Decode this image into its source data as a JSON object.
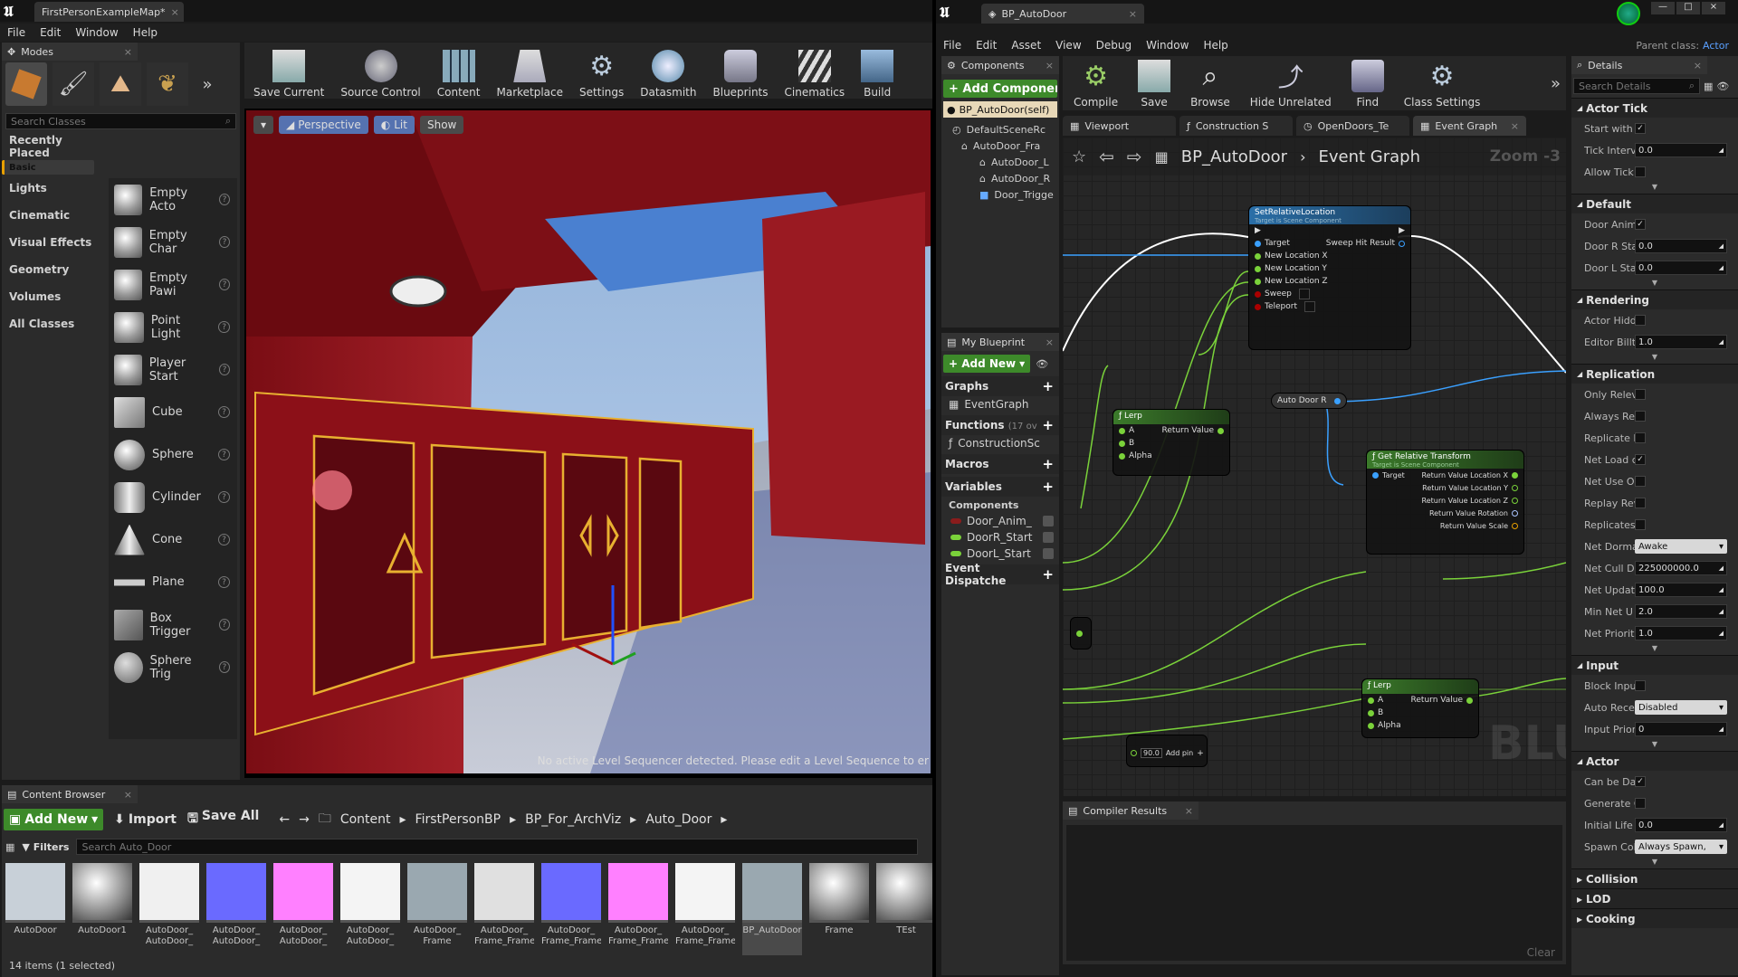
{
  "left_window": {
    "tab_title": "FirstPersonExampleMap*",
    "menu": [
      "File",
      "Edit",
      "Window",
      "Help"
    ],
    "modes": {
      "title": "Modes",
      "search_placeholder": "Search Classes",
      "categories": [
        "Recently Placed",
        "Basic",
        "Lights",
        "Cinematic",
        "Visual Effects",
        "Geometry",
        "Volumes",
        "All Classes"
      ],
      "selected_category": "Basic",
      "items": [
        "Empty Acto",
        "Empty Char",
        "Empty Pawi",
        "Point Light",
        "Player Start",
        "Cube",
        "Sphere",
        "Cylinder",
        "Cone",
        "Plane",
        "Box Trigger",
        "Sphere Trig"
      ]
    },
    "toolbar": [
      "Save Current",
      "Source Control",
      "Content",
      "Marketplace",
      "Settings",
      "Datasmith",
      "Blueprints",
      "Cinematics",
      "Build"
    ],
    "viewport": {
      "perspective": "Perspective",
      "lit": "Lit",
      "show": "Show",
      "message": "No active Level Sequencer detected. Please edit a Level Sequence to er"
    },
    "content_browser": {
      "title": "Content Browser",
      "add_new": "Add New",
      "import": "Import",
      "save_all": "Save All",
      "breadcrumbs": [
        "Content",
        "FirstPersonBP",
        "BP_For_ArchViz",
        "Auto_Door"
      ],
      "filters": "Filters",
      "search_placeholder": "Search Auto_Door",
      "assets": [
        {
          "l1": "AutoDoor",
          "l2": ""
        },
        {
          "l1": "AutoDoor1",
          "l2": ""
        },
        {
          "l1": "AutoDoor_",
          "l2": "AutoDoor_"
        },
        {
          "l1": "AutoDoor_",
          "l2": "AutoDoor_"
        },
        {
          "l1": "AutoDoor_",
          "l2": "AutoDoor_"
        },
        {
          "l1": "AutoDoor_",
          "l2": "AutoDoor_"
        },
        {
          "l1": "AutoDoor_",
          "l2": "Frame"
        },
        {
          "l1": "AutoDoor_",
          "l2": "Frame_Frame"
        },
        {
          "l1": "AutoDoor_",
          "l2": "Frame_Frame"
        },
        {
          "l1": "AutoDoor_",
          "l2": "Frame_Frame"
        },
        {
          "l1": "AutoDoor_",
          "l2": "Frame_Frame"
        },
        {
          "l1": "BP_AutoDoor",
          "l2": ""
        },
        {
          "l1": "Frame",
          "l2": ""
        },
        {
          "l1": "TEst",
          "l2": ""
        }
      ],
      "status": "14 items (1 selected)"
    }
  },
  "right_window": {
    "tab_title": "BP_AutoDoor",
    "parent_class_label": "Parent class:",
    "parent_class_value": "Actor",
    "menu": [
      "File",
      "Edit",
      "Asset",
      "View",
      "Debug",
      "Window",
      "Help"
    ],
    "components": {
      "title": "Components",
      "add_button": "+ Add Component",
      "self": "BP_AutoDoor(self)",
      "tree": [
        "DefaultSceneRc",
        "AutoDoor_Fra",
        "AutoDoor_L",
        "AutoDoor_R",
        "Door_Trigge"
      ]
    },
    "toolbar": [
      "Compile",
      "Save",
      "Browse",
      "Hide Unrelated",
      "Find",
      "Class Settings"
    ],
    "tabs": [
      "Viewport",
      "Construction S",
      "OpenDoors_Te",
      "Event Graph"
    ],
    "graph_breadcrumb": [
      "BP_AutoDoor",
      "Event Graph"
    ],
    "zoom": "Zoom -3",
    "watermark": "BLUEPRINT",
    "my_blueprint": {
      "title": "My Blueprint",
      "add_new": "+ Add New",
      "graphs": "Graphs",
      "event_graph": "EventGraph",
      "functions": "Functions",
      "functions_count": "(17 ov",
      "construction": "ConstructionSc",
      "macros": "Macros",
      "variables": "Variables",
      "components": "Components",
      "vars": [
        {
          "name": "Door_Anim_",
          "color": "#8a1c1c"
        },
        {
          "name": "DoorR_Start",
          "color": "#7ad23a"
        },
        {
          "name": "DoorL_Start",
          "color": "#7ad23a"
        }
      ],
      "dispatchers": "Event Dispatche"
    },
    "nodes": {
      "set_rel": {
        "title": "SetRelativeLocation",
        "sub": "Target is Scene Component",
        "pins": [
          "Target",
          "New Location X",
          "New Location Y",
          "New Location Z",
          "Sweep",
          "Teleport"
        ],
        "out": "Sweep Hit Result"
      },
      "lerp1": {
        "title": "Lerp",
        "pins": [
          "A",
          "B",
          "Alpha"
        ],
        "out": "Return Value"
      },
      "auto_door_r": "Auto Door R",
      "get_rel": {
        "title": "Get Relative Transform",
        "sub": "Target is Scene Component",
        "pins": [
          "Target"
        ],
        "outs": [
          "Return Value Location X",
          "Return Value Location Y",
          "Return Value Location Z",
          "Return Value Rotation",
          "Return Value Scale"
        ]
      },
      "lerp2": {
        "title": "Lerp",
        "pins": [
          "A",
          "B",
          "Alpha"
        ],
        "out": "Return Value"
      },
      "add_node": {
        "value": "90.0",
        "label": "Add pin"
      }
    },
    "compiler": {
      "title": "Compiler Results",
      "clear": "Clear"
    },
    "details": {
      "title": "Details",
      "search_placeholder": "Search Details",
      "sections": [
        {
          "name": "Actor Tick",
          "rows": [
            {
              "l": "Start with",
              "t": "chk",
              "v": "✓"
            },
            {
              "l": "Tick Interv",
              "t": "inp",
              "v": "0.0"
            },
            {
              "l": "Allow Tick",
              "t": "chk",
              "v": ""
            }
          ]
        },
        {
          "name": "Default",
          "rows": [
            {
              "l": "Door Anim",
              "t": "chk",
              "v": "✓"
            },
            {
              "l": "Door R Sta",
              "t": "inp",
              "v": "0.0"
            },
            {
              "l": "Door L Sta",
              "t": "inp",
              "v": "0.0"
            }
          ]
        },
        {
          "name": "Rendering",
          "rows": [
            {
              "l": "Actor Hidd",
              "t": "chk",
              "v": ""
            },
            {
              "l": "Editor Billt",
              "t": "inp",
              "v": "1.0"
            }
          ]
        },
        {
          "name": "Replication",
          "rows": [
            {
              "l": "Only Relev",
              "t": "chk",
              "v": ""
            },
            {
              "l": "Always Re",
              "t": "chk",
              "v": ""
            },
            {
              "l": "Replicate I",
              "t": "chk",
              "v": ""
            },
            {
              "l": "Net Load c",
              "t": "chk",
              "v": "✓"
            },
            {
              "l": "Net Use O",
              "t": "chk",
              "v": ""
            },
            {
              "l": "Replay Rev",
              "t": "chk",
              "v": ""
            },
            {
              "l": "Replicates",
              "t": "chk",
              "v": ""
            },
            {
              "l": "Net Dorma",
              "t": "sel",
              "v": "Awake"
            },
            {
              "l": "Net Cull Di",
              "t": "inp",
              "v": "225000000.0"
            },
            {
              "l": "Net Updat",
              "t": "inp",
              "v": "100.0"
            },
            {
              "l": "Min Net U",
              "t": "inp",
              "v": "2.0"
            },
            {
              "l": "Net Priorit",
              "t": "inp",
              "v": "1.0"
            }
          ]
        },
        {
          "name": "Input",
          "rows": [
            {
              "l": "Block Inpu",
              "t": "chk",
              "v": ""
            },
            {
              "l": "Auto Rece",
              "t": "sel",
              "v": "Disabled"
            },
            {
              "l": "Input Prior",
              "t": "inp",
              "v": "0"
            }
          ]
        },
        {
          "name": "Actor",
          "rows": [
            {
              "l": "Can be Dai",
              "t": "chk",
              "v": "✓"
            },
            {
              "l": "Generate C",
              "t": "chk",
              "v": ""
            },
            {
              "l": "Initial Life",
              "t": "inp",
              "v": "0.0"
            },
            {
              "l": "Spawn Col",
              "t": "sel",
              "v": "Always Spawn,"
            }
          ]
        }
      ],
      "collapsed": [
        "Collision",
        "LOD",
        "Cooking"
      ]
    }
  }
}
